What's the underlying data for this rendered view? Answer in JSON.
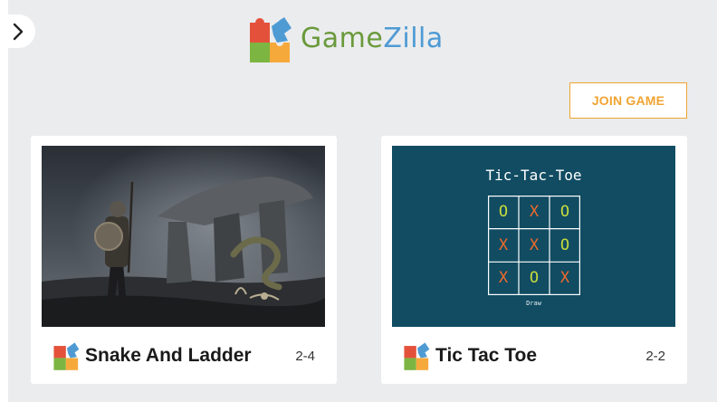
{
  "sidebar": {
    "toggle_icon": "chevron-right-icon"
  },
  "brand": {
    "name_part1": "Game",
    "name_part2": "Zilla",
    "logo_icon": "puzzle-pieces-icon",
    "colors": {
      "game": "#6a9a3c",
      "zilla": "#4e9bd4",
      "red": "#e4513b",
      "orange": "#f6a93b",
      "green": "#7cb541",
      "blue": "#4e9bd4"
    }
  },
  "header": {
    "join_label": "JOIN GAME",
    "accent": "#f0a432"
  },
  "games": [
    {
      "title": "Snake And Ladder",
      "players": "2-4",
      "image": "warrior-snake-artwork"
    },
    {
      "title": "Tic Tac Toe",
      "players": "2-2",
      "image": "tic-tac-toe-preview"
    }
  ],
  "tictactoe_preview": {
    "heading": "Tic-Tac-Toe",
    "board": [
      [
        "O",
        "X",
        "O"
      ],
      [
        "X",
        "X",
        "O"
      ],
      [
        "X",
        "O",
        "X"
      ]
    ],
    "caption": "Draw",
    "colors": {
      "background": "#114c62",
      "x": "#f16a2a",
      "o": "#c9dc3c"
    }
  }
}
